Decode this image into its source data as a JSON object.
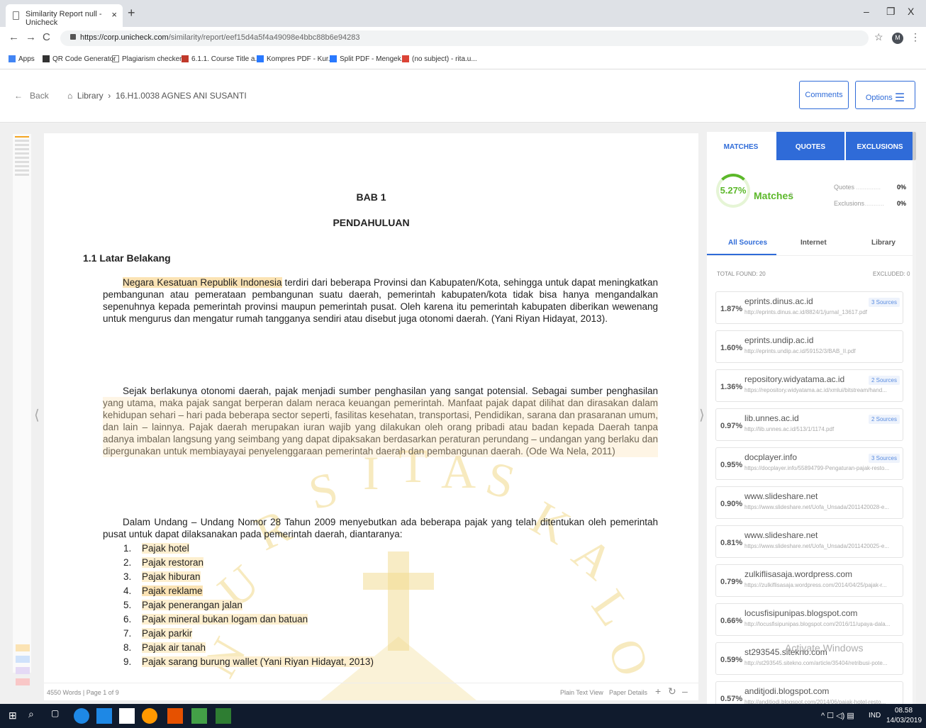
{
  "browser": {
    "tab_title": "Similarity Report null - Unicheck",
    "url_host": "https://corp.unicheck.com",
    "url_path": "/similarity/report/eef15d4a5f4a49098e4bbc88b6e94283",
    "profile": "M",
    "bookmarks": [
      "Apps",
      "QR Code Generator",
      "Plagiarism checker -",
      "6.1.1. Course Title a...",
      "Kompres PDF - Kur...",
      "Split PDF - Mengek...",
      "(no subject) - rita.u..."
    ]
  },
  "header": {
    "back": "Back",
    "library": "Library",
    "doc_name": "16.H1.0038 AGNES ANI SUSANTI",
    "comments": "Comments",
    "options": "Options"
  },
  "doc": {
    "chapter": "BAB 1",
    "chapter_title": "PENDAHULUAN",
    "section": "1.1  Latar Belakang",
    "p1_hl": "Negara Kesatuan Republik Indonesia",
    "p1_rest": " terdiri dari beberapa Provinsi dan Kabupaten/Kota, sehingga untuk dapat meningkatkan pembangunan atau pemerataan pembangunan suatu daerah, pemerintah kabupaten/kota tidak bisa hanya mengandalkan sepenuhnya kepada pemerintah provinsi maupun pemerintah pusat. Oleh karena itu pemerintah kabupaten diberikan wewenang untuk mengurus dan mengatur rumah tangganya sendiri atau disebut juga otonomi daerah. (Yani Riyan Hidayat, 2013).",
    "p2": "Sejak berlakunya otonomi daerah, pajak menjadi sumber penghasilan yang sangat potensial. Sebagai sumber penghasilan yang utama, maka pajak sangat berperan dalam neraca keuangan pemerintah. Manfaat pajak dapat dilihat dan dirasakan dalam kehidupan sehari – hari pada beberapa sector seperti, fasilitas kesehatan, transportasi, Pendidikan, sarana dan prasaranan umum, dan lain – lainnya. Pajak daerah merupakan iuran wajib yang dilakukan oleh orang pribadi atau badan kepada Daerah tanpa adanya imbalan langsung yang seimbang yang dapat dipaksakan berdasarkan peraturan perundang – undangan yang berlaku dan dipergunakan untuk membiayayai penyelenggaraan pemerintah daerah dan pembangunan daerah. (Ode Wa Nela, 2011)",
    "p3": "Dalam Undang – Undang Nomor 28 Tahun 2009 menyebutkan ada beberapa pajak yang telah ditentukan oleh pemerintah pusat untuk dapat dilaksanakan pada pemerintah daerah, diantaranya:",
    "list": [
      {
        "n": "1.",
        "t": "Pajak hotel"
      },
      {
        "n": "2.",
        "t": "Pajak restoran"
      },
      {
        "n": "3.",
        "t": "Pajak hiburan"
      },
      {
        "n": "4.",
        "t": "Pajak reklame"
      },
      {
        "n": "5.",
        "t": "Pajak penerangan jalan"
      },
      {
        "n": "6.",
        "t": "Pajak mineral bukan logam dan batuan"
      },
      {
        "n": "7.",
        "t": "Pajak parkir"
      },
      {
        "n": "8.",
        "t": "Pajak air tanah"
      },
      {
        "n": "9.",
        "t": "Pajak sarang burung wallet  (Yani Riyan Hidayat, 2013)"
      }
    ],
    "footer": "4550 Words | Page 1 of 9",
    "plain_text": "Plain Text View",
    "paper_details": "Paper Details"
  },
  "panel": {
    "tabs": [
      "MATCHES",
      "QUOTES",
      "EXCLUSIONS"
    ],
    "percent": "5.27%",
    "matches": "Matches",
    "quotes_label": "Quotes",
    "quotes_val": "0%",
    "excl_label": "Exclusions",
    "excl_val": "0%",
    "source_tabs": [
      "All Sources",
      "Internet",
      "Library"
    ],
    "total": "TOTAL FOUND: 20",
    "excluded": "EXCLUDED: 0",
    "sources": [
      {
        "pct": "1.87%",
        "domain": "eprints.dinus.ac.id",
        "url": "http://eprints.dinus.ac.id/8824/1/jurnal_13617.pdf",
        "badge": "3 Sources"
      },
      {
        "pct": "1.60%",
        "domain": "eprints.undip.ac.id",
        "url": "http://eprints.undip.ac.id/59152/3/BAB_II.pdf",
        "badge": ""
      },
      {
        "pct": "1.36%",
        "domain": "repository.widyatama.ac.id",
        "url": "https://repository.widyatama.ac.id/xmlui/bitstream/hand...",
        "badge": "2 Sources"
      },
      {
        "pct": "0.97%",
        "domain": "lib.unnes.ac.id",
        "url": "http://lib.unnes.ac.id/513/1/1174.pdf",
        "badge": "2 Sources"
      },
      {
        "pct": "0.95%",
        "domain": "docplayer.info",
        "url": "https://docplayer.info/55894799-Pengaturan-pajak-resto...",
        "badge": "3 Sources"
      },
      {
        "pct": "0.90%",
        "domain": "www.slideshare.net",
        "url": "https://www.slideshare.net/Uofa_Unsada/2011420028-e...",
        "badge": ""
      },
      {
        "pct": "0.81%",
        "domain": "www.slideshare.net",
        "url": "https://www.slideshare.net/Uofa_Unsada/2011420025-e...",
        "badge": ""
      },
      {
        "pct": "0.79%",
        "domain": "zulkiflisasaja.wordpress.com",
        "url": "https://zulkiflisasaja.wordpress.com/2014/04/25/pajak-r...",
        "badge": ""
      },
      {
        "pct": "0.66%",
        "domain": "locusfisipunipas.blogspot.com",
        "url": "http://locusfisipunipas.blogspot.com/2016/11/upaya-dala...",
        "badge": ""
      },
      {
        "pct": "0.59%",
        "domain": "st293545.sitekno.com",
        "url": "http://st293545.sitekno.com/article/35404/retribusi-pote...",
        "badge": ""
      },
      {
        "pct": "0.57%",
        "domain": "anditjodi.blogspot.com",
        "url": "http://anditjodi.blogspot.com/2014/06/pajak-hotel-resto...",
        "badge": ""
      }
    ]
  },
  "watermark": {
    "letters": [
      "R",
      "S",
      "I",
      "T",
      "A",
      "S",
      "K",
      "A",
      "U",
      "N",
      "I",
      "V",
      "E",
      "L",
      "O",
      "I",
      "K"
    ],
    "activate": "Activate Windows"
  },
  "taskbar": {
    "lang": "IND",
    "time": "08.58",
    "date": "14/03/2019"
  }
}
